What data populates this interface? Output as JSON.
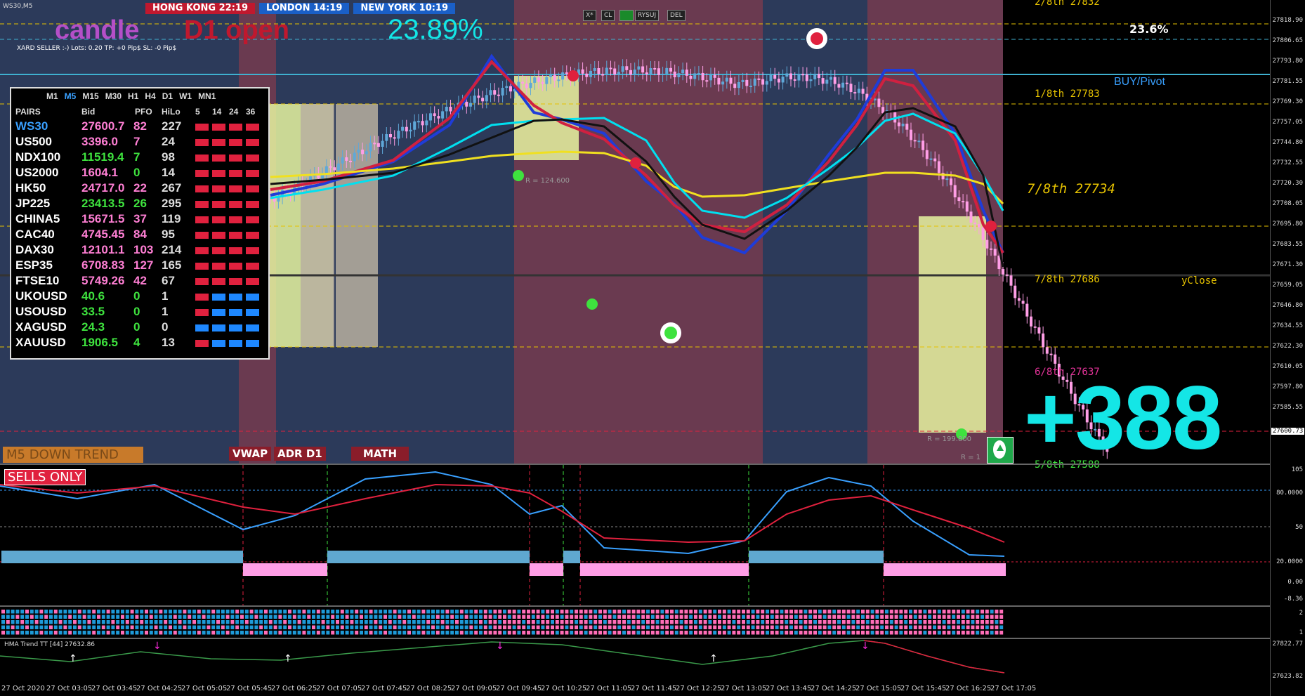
{
  "window": {
    "title": "WS30,M5"
  },
  "clocks": [
    {
      "label": "HONG KONG  22:19",
      "color": "#c0182e"
    },
    {
      "label": "LONDON  14:19",
      "color": "#1a5fc7"
    },
    {
      "label": "NEW YORK  10:19",
      "color": "#1a5fc7"
    }
  ],
  "headline": {
    "candle": "candle",
    "d1open": "D1 open",
    "percent": "23.89%"
  },
  "trade_info": "XARD SELLER :-)   Lots: 0.20    TP: +0 Pip$    SL: -0 Pip$",
  "toolbar": [
    "X*",
    "CL",
    "",
    "RYSUJ",
    "DEL"
  ],
  "fib_label": "23.6%",
  "pivots": {
    "p28": "2/8th   27832",
    "buy": "BUY/Pivot",
    "p18": "1/8th   27783",
    "p78a": "7/8th  27734",
    "p78b": "7/8th  27686",
    "yclose": "yClose",
    "p68": "6/8th   27637",
    "p58": "5/8th   27588"
  },
  "big_counter": "+388",
  "markers": {
    "r1": "R = 124.600",
    "r2": "R = 199.800",
    "r3": "R = 1"
  },
  "bottom_buttons": {
    "trend": "M5 DOWN TREND",
    "vwap": "VWAP",
    "adr": "ADR D1",
    "math": "MATH"
  },
  "sells_only": "SELLS ONLY",
  "panel": {
    "timeframes": [
      "M1",
      "M5",
      "M15",
      "M30",
      "H1",
      "H4",
      "D1",
      "W1",
      "MN1"
    ],
    "active_tf": "M5",
    "header": {
      "pairs": "PAIRS",
      "bid": "Bid",
      "pfo": "PFO",
      "hilo": "HiLo",
      "c5": "5",
      "c14": "14",
      "c24": "24",
      "c36": "36"
    },
    "rows": [
      {
        "pair": "WS30",
        "bid": "27600.7",
        "pfo": "82",
        "hilo": "227",
        "pc": "#39a0ff",
        "bc": "#ff7fd4",
        "fc": "#ff7fd4",
        "bars": [
          "r",
          "r",
          "r",
          "r"
        ]
      },
      {
        "pair": "US500",
        "bid": "3396.0",
        "pfo": "7",
        "hilo": "24",
        "pc": "#fff",
        "bc": "#ff7fd4",
        "fc": "#ff7fd4",
        "bars": [
          "r",
          "r",
          "r",
          "r"
        ]
      },
      {
        "pair": "NDX100",
        "bid": "11519.4",
        "pfo": "7",
        "hilo": "98",
        "pc": "#fff",
        "bc": "#3ee23e",
        "fc": "#3ee23e",
        "bars": [
          "r",
          "r",
          "r",
          "r"
        ]
      },
      {
        "pair": "US2000",
        "bid": "1604.1",
        "pfo": "0",
        "hilo": "14",
        "pc": "#fff",
        "bc": "#ff7fd4",
        "fc": "#3ee23e",
        "bars": [
          "r",
          "r",
          "r",
          "r"
        ]
      },
      {
        "pair": "HK50",
        "bid": "24717.0",
        "pfo": "22",
        "hilo": "267",
        "pc": "#fff",
        "bc": "#ff7fd4",
        "fc": "#ff7fd4",
        "bars": [
          "r",
          "r",
          "r",
          "r"
        ]
      },
      {
        "pair": "JP225",
        "bid": "23413.5",
        "pfo": "26",
        "hilo": "295",
        "pc": "#fff",
        "bc": "#3ee23e",
        "fc": "#3ee23e",
        "bars": [
          "r",
          "r",
          "r",
          "r"
        ]
      },
      {
        "pair": "CHINA5",
        "bid": "15671.5",
        "pfo": "37",
        "hilo": "119",
        "pc": "#fff",
        "bc": "#ff7fd4",
        "fc": "#ff7fd4",
        "bars": [
          "r",
          "r",
          "r",
          "r"
        ]
      },
      {
        "pair": "CAC40",
        "bid": "4745.45",
        "pfo": "84",
        "hilo": "95",
        "pc": "#fff",
        "bc": "#ff7fd4",
        "fc": "#ff7fd4",
        "bars": [
          "r",
          "r",
          "r",
          "r"
        ]
      },
      {
        "pair": "DAX30",
        "bid": "12101.1",
        "pfo": "103",
        "hilo": "214",
        "pc": "#fff",
        "bc": "#ff7fd4",
        "fc": "#ff7fd4",
        "bars": [
          "r",
          "r",
          "r",
          "r"
        ]
      },
      {
        "pair": "ESP35",
        "bid": "6708.83",
        "pfo": "127",
        "hilo": "165",
        "pc": "#fff",
        "bc": "#ff7fd4",
        "fc": "#ff7fd4",
        "bars": [
          "r",
          "r",
          "r",
          "r"
        ]
      },
      {
        "pair": "FTSE10",
        "bid": "5749.26",
        "pfo": "42",
        "hilo": "67",
        "pc": "#fff",
        "bc": "#ff7fd4",
        "fc": "#ff7fd4",
        "bars": [
          "r",
          "r",
          "r",
          "r"
        ]
      },
      {
        "pair": "UKOUSD",
        "bid": "40.6",
        "pfo": "0",
        "hilo": "1",
        "pc": "#fff",
        "bc": "#3ee23e",
        "fc": "#3ee23e",
        "bars": [
          "r",
          "b",
          "b",
          "b"
        ]
      },
      {
        "pair": "USOUSD",
        "bid": "33.5",
        "pfo": "0",
        "hilo": "1",
        "pc": "#fff",
        "bc": "#3ee23e",
        "fc": "#3ee23e",
        "bars": [
          "r",
          "b",
          "b",
          "b"
        ]
      },
      {
        "pair": "XAGUSD",
        "bid": "24.3",
        "pfo": "0",
        "hilo": "0",
        "pc": "#fff",
        "bc": "#3ee23e",
        "fc": "#3ee23e",
        "bars": [
          "b",
          "b",
          "b",
          "b"
        ]
      },
      {
        "pair": "XAUUSD",
        "bid": "1906.5",
        "pfo": "4",
        "hilo": "13",
        "pc": "#fff",
        "bc": "#3ee23e",
        "fc": "#3ee23e",
        "bars": [
          "r",
          "b",
          "b",
          "b"
        ]
      }
    ]
  },
  "price_axis": [
    "27818.90",
    "27806.65",
    "27793.80",
    "27781.55",
    "27769.30",
    "27757.05",
    "27744.80",
    "27732.55",
    "27720.30",
    "27708.05",
    "27695.80",
    "27683.55",
    "27671.30",
    "27659.05",
    "27646.80",
    "27634.55",
    "27622.30",
    "27610.05",
    "27597.80",
    "27585.55"
  ],
  "current_price": "27600.73",
  "osc_axis": [
    "105",
    "80.0000",
    "50",
    "20.0000",
    "0.00",
    "-8.36"
  ],
  "strip_axis": [
    "2",
    "1"
  ],
  "hma": {
    "label": "HMA Trend TT [44] 27632.86",
    "axis_top": "27822.77",
    "axis_bottom": "27623.82"
  },
  "time_axis": [
    "27 Oct 2020",
    "27 Oct 03:05",
    "27 Oct 03:45",
    "27 Oct 04:25",
    "27 Oct 05:05",
    "27 Oct 05:45",
    "27 Oct 06:25",
    "27 Oct 07:05",
    "27 Oct 07:45",
    "27 Oct 08:25",
    "27 Oct 09:05",
    "27 Oct 09:45",
    "27 Oct 10:25",
    "27 Oct 11:05",
    "27 Oct 11:45",
    "27 Oct 12:25",
    "27 Oct 13:05",
    "27 Oct 13:45",
    "27 Oct 14:25",
    "27 Oct 15:05",
    "27 Oct 15:45",
    "27 Oct 16:25",
    "27 Oct 17:05"
  ],
  "colors": {
    "bar_red": "#e0213e",
    "bar_blue": "#1e88ff",
    "cyan": "#14e6e6"
  }
}
